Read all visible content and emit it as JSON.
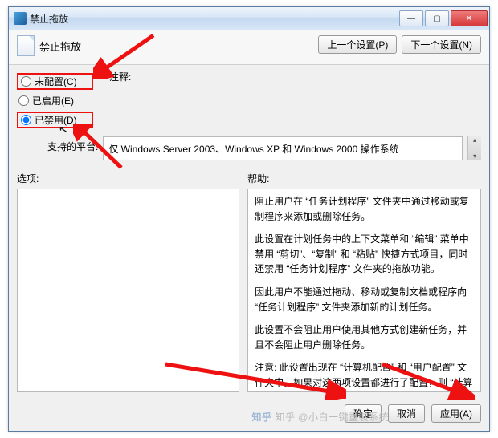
{
  "window": {
    "title": "禁止拖放"
  },
  "header": {
    "title": "禁止拖放",
    "prev_btn": "上一个设置(P)",
    "next_btn": "下一个设置(N)"
  },
  "radios": {
    "not_configured": "未配置(C)",
    "enabled": "已启用(E)",
    "disabled": "已禁用(D)"
  },
  "notes_label": "注释:",
  "platform": {
    "label": "支持的平台:",
    "text": "仅 Windows Server 2003、Windows XP 和 Windows 2000 操作系统"
  },
  "options_label": "选项:",
  "help_label": "帮助:",
  "help_paras": [
    "阻止用户在 “任务计划程序” 文件夹中通过移动或复制程序来添加或删除任务。",
    "此设置在计划任务中的上下文菜单和 “编辑” 菜单中禁用 “剪切”、“复制” 和 “粘贴” 快捷方式项目，同时还禁用 “任务计划程序” 文件夹的拖放功能。",
    "因此用户不能通过拖动、移动或复制文档或程序向 “任务计划程序” 文件夹添加新的计划任务。",
    "此设置不会阻止用户使用其他方式创建新任务，并且不会阻止用户删除任务。",
    "注意: 此设置出现在 “计算机配置” 和 “用户配置” 文件夹中。如果对这两项设置都进行了配置，则 “计算机配置” 中的设置优先于 “用户配置” 中的设置。"
  ],
  "footer": {
    "ok": "确定",
    "cancel": "取消",
    "apply": "应用(A)"
  },
  "watermark": "知乎 @小白一键重装系统"
}
